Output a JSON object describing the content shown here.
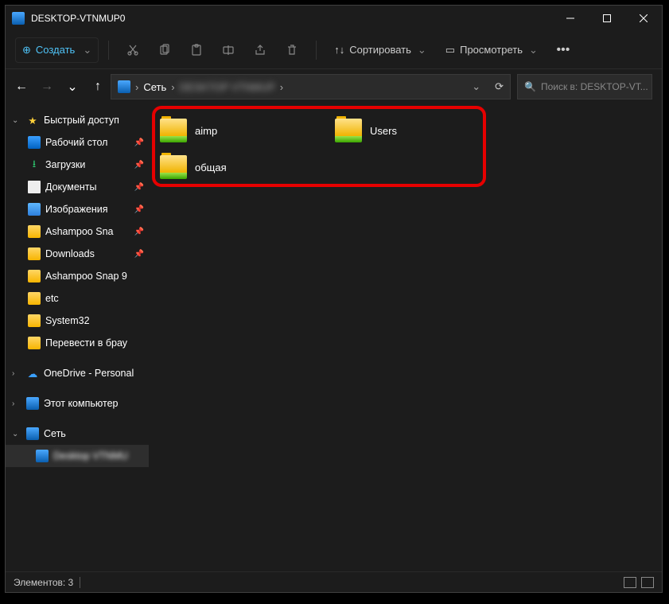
{
  "window": {
    "title": "DESKTOP-VTNMUP0"
  },
  "toolbar": {
    "create_label": "Создать",
    "sort_label": "Сортировать",
    "view_label": "Просмотреть"
  },
  "address": {
    "root": "Сеть",
    "blurred_segment": "DESKTOP  VTNMUP"
  },
  "search": {
    "placeholder": "Поиск в: DESKTOP-VT..."
  },
  "sidebar": {
    "quick_access": "Быстрый доступ",
    "items": [
      {
        "label": "Рабочий стол",
        "icon": "desktop",
        "pinned": true
      },
      {
        "label": "Загрузки",
        "icon": "download",
        "pinned": true
      },
      {
        "label": "Документы",
        "icon": "doc",
        "pinned": true
      },
      {
        "label": "Изображения",
        "icon": "img",
        "pinned": true
      },
      {
        "label": "Ashampoo Sna",
        "icon": "folder",
        "pinned": true
      },
      {
        "label": "Downloads",
        "icon": "folder",
        "pinned": true
      },
      {
        "label": "Ashampoo Snap 9",
        "icon": "folder",
        "pinned": false
      },
      {
        "label": "etc",
        "icon": "folder",
        "pinned": false
      },
      {
        "label": "System32",
        "icon": "folder",
        "pinned": false
      },
      {
        "label": "Перевести в брау",
        "icon": "folder",
        "pinned": false
      }
    ],
    "onedrive": "OneDrive - Personal",
    "this_pc": "Этот компьютер",
    "network": "Сеть",
    "network_child": "Desktop  VTNMU"
  },
  "content": {
    "items": [
      {
        "label": "aimp"
      },
      {
        "label": "Users"
      },
      {
        "label": "общая"
      }
    ]
  },
  "status": {
    "text": "Элементов: 3"
  }
}
